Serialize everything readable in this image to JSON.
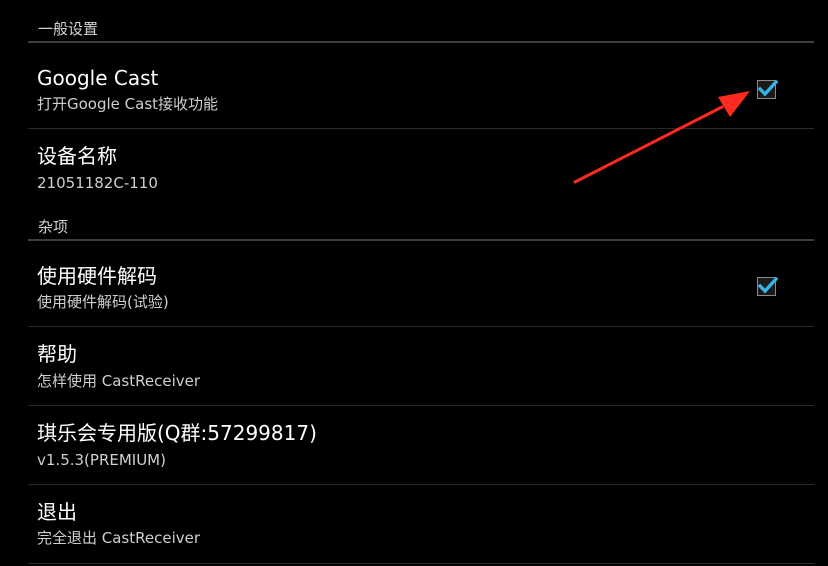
{
  "sections": {
    "general": {
      "label": "一般设置"
    },
    "misc": {
      "label": "杂项"
    }
  },
  "items": {
    "google_cast": {
      "title": "Google Cast",
      "summary": "打开Google Cast接收功能",
      "checked": true
    },
    "device_name": {
      "title": "设备名称",
      "summary": "21051182C-110"
    },
    "hw_decode": {
      "title": "使用硬件解码",
      "summary": "使用硬件解码(试验)",
      "checked": true
    },
    "help": {
      "title": "帮助",
      "summary": "怎样使用 CastReceiver"
    },
    "version": {
      "title": "琪乐会专用版(Q群:57299817)",
      "summary": "v1.5.3(PREMIUM)"
    },
    "exit": {
      "title": "退出",
      "summary": "完全退出 CastReceiver"
    }
  },
  "colors": {
    "background": "#000000",
    "checkmark": "#33b5e5",
    "annotation_arrow": "#ff2a1f"
  },
  "icons": {
    "checkbox": "checkmark-icon",
    "annotation": "red-arrow-icon"
  }
}
